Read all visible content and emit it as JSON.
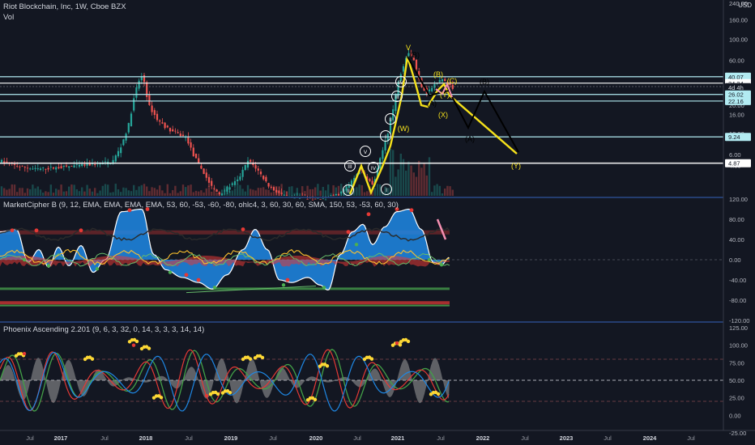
{
  "header": {
    "symbol": "Riot Blockchain, Inc, 1W, Cboe BZX",
    "volume": "Vol",
    "currency": "USD"
  },
  "panes": {
    "marketcipher": {
      "label": "MarketCipher B (9, 12, EMA, EMA, EMA, EMA, 53, 60, -53, -60, -80, ohlc4, 3, 60, 30, 60, SMA, 150, 53, -53, 60, 30)"
    },
    "phoenix": {
      "label": "Phoenix Ascending 2.201 (9, 6, 3, 32, 0, 14, 3, 3, 3, 14, 14)"
    }
  },
  "colors": {
    "background": "#131722",
    "up": "#26a69a",
    "down": "#ef5350",
    "wave_yellow": "#f5e11b",
    "level_line": "#b2ebf2",
    "mc_blue": "#1e88e5",
    "mc_red": "#e53935",
    "mc_green": "#4caf50"
  },
  "chart_data": [
    {
      "type": "candlestick",
      "title": "Riot Blockchain, Inc, 1W, Cboe BZX",
      "y_scale": "log",
      "y_ticks": [
        "4.60",
        "6.00",
        "10.00",
        "16.00",
        "20.00",
        "40.00",
        "60.00",
        "100.00",
        "160.00",
        "240.00"
      ],
      "x_ticks": [
        "Jul",
        "2017",
        "Jul",
        "2018",
        "Jul",
        "2019",
        "Jul",
        "2020",
        "Jul",
        "2021",
        "Jul",
        "2022",
        "Jul",
        "2023",
        "Jul",
        "2024",
        "Jul"
      ],
      "price_levels": [
        {
          "label": "40.07",
          "value": 40.07,
          "color": "#b2ebf2"
        },
        {
          "label": "34.24",
          "value": 34.24,
          "color": "#ffffff"
        },
        {
          "label": "4d 4h",
          "value": 31.0,
          "color": "#ffffff"
        },
        {
          "label": "26.02",
          "value": 26.02,
          "color": "#b2ebf2"
        },
        {
          "label": "22.16",
          "value": 22.16,
          "color": "#b2ebf2"
        },
        {
          "label": "9.24",
          "value": 9.24,
          "color": "#b2ebf2"
        },
        {
          "label": "4.87",
          "value": 4.87,
          "color": "#ffffff"
        }
      ],
      "wave_labels": [
        "(B)",
        "(A)",
        "(C)",
        "(B)",
        "(Y)",
        "(X)",
        "(W)",
        "(A)",
        "(B)",
        "(Y)",
        "V",
        "IV",
        "III",
        "II",
        "I",
        "V",
        "IV",
        "III",
        "II",
        "I"
      ]
    },
    {
      "type": "line",
      "title": "MarketCipher B (9, 12, EMA, EMA, EMA, EMA, 53, 60, -53, -60, -80, ohlc4, 3, 60, 30, 60, SMA, 150, 53, -53, 60, 30)",
      "y_ticks": [
        "120.00",
        "80.00",
        "40.00",
        "0.00",
        "-40.00",
        "-80.00",
        "-120.00"
      ],
      "ylim": [
        -120,
        120
      ]
    },
    {
      "type": "line",
      "title": "Phoenix Ascending 2.201 (9, 6, 3, 32, 0, 14, 3, 3, 3, 14, 14)",
      "y_ticks": [
        "125.00",
        "100.00",
        "75.00",
        "50.00",
        "25.00",
        "0.00",
        "-25.00"
      ],
      "ylim": [
        -25,
        125
      ]
    }
  ]
}
